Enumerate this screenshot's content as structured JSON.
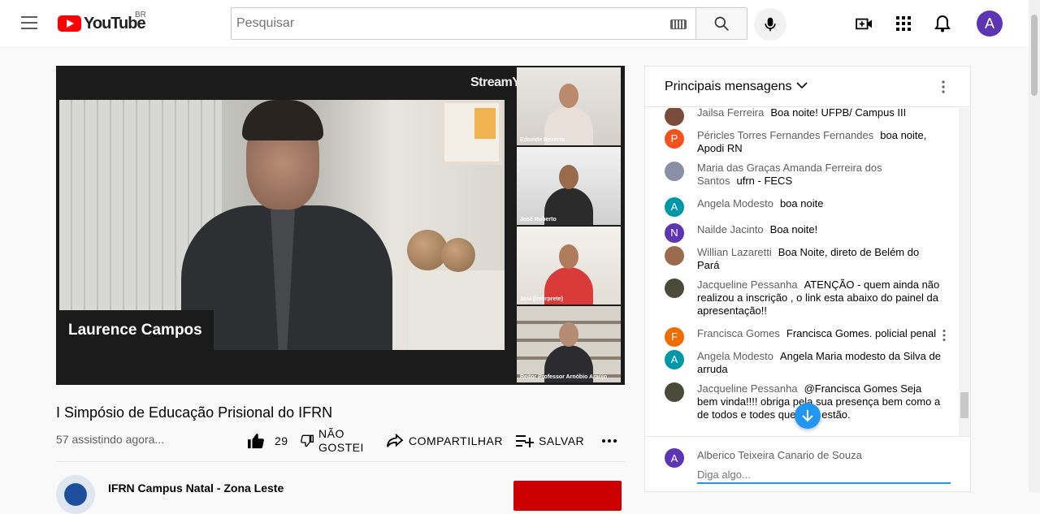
{
  "header": {
    "logo_text": "YouTube",
    "region": "BR",
    "search_placeholder": "Pesquisar",
    "avatar_letter": "A",
    "icons": [
      "menu-icon",
      "keyboard-icon",
      "search-icon",
      "mic-icon",
      "create-video-icon",
      "apps-icon",
      "bell-icon"
    ]
  },
  "video": {
    "brand": "StreamYard",
    "main_speaker": "Laurence Campos",
    "participants": [
      {
        "name": "Edneide Bezerra"
      },
      {
        "name": "José Roberto"
      },
      {
        "name": "Josi (intérprete)"
      },
      {
        "name": "Reitor Professor Arnóbio Araújo"
      }
    ],
    "title": "I Simpósio de Educação Prisional do IFRN",
    "watching": "57 assistindo agora...",
    "likes": "29",
    "dislike_label_1": "NÃO",
    "dislike_label_2": "GOSTEI",
    "share_label": "COMPARTILHAR",
    "save_label": "SALVAR"
  },
  "channel": {
    "name": "IFRN Campus Natal - Zona Leste"
  },
  "chat": {
    "title": "Principais mensagens",
    "messages": [
      {
        "author": "Jailsa Ferreira",
        "text": "Boa noite! UFPB/ Campus III",
        "avatar": "",
        "color": "#7a4a3a"
      },
      {
        "author": "Péricles Torres Fernandes Fernandes",
        "text": "boa noite, Apodi RN",
        "avatar": "P",
        "color": "#f4511e"
      },
      {
        "author": "Maria das Graças Amanda Ferreira dos Santos",
        "text": "ufrn - FECS",
        "avatar": "",
        "color": "#8a8fa8"
      },
      {
        "author": "Angela Modesto",
        "text": "boa noite",
        "avatar": "A",
        "color": "#0097a7"
      },
      {
        "author": "Nailde Jacinto",
        "text": "Boa noite!",
        "avatar": "N",
        "color": "#5e35b1"
      },
      {
        "author": "Willian Lazaretti",
        "text": "Boa Noite, direto de Belém do Pará",
        "avatar": "",
        "color": "#9c6b4e"
      },
      {
        "author": "Jacqueline Pessanha",
        "text": "ATENÇÃO - quem ainda não realizou a inscrição , o link esta abaixo do painel da apresentação!!",
        "avatar": "",
        "color": "#4a4a3a"
      },
      {
        "author": "Francisca Gomes",
        "text": "Francisca Gomes. policial penal",
        "avatar": "F",
        "color": "#ef6c00"
      },
      {
        "author": "Angela Modesto",
        "text": "Angela Maria modesto da Silva de arruda",
        "avatar": "A",
        "color": "#0097a7"
      },
      {
        "author": "Jacqueline Pessanha",
        "text": "@Francisca Gomes Seja bem vinda!!!! obriga pela sua presença bem como a de todos e todes que aqui estão.",
        "avatar": "",
        "color": "#4a4a3a"
      }
    ],
    "input_user": "Alberico Teixeira Canario de Souza",
    "input_avatar": "A",
    "input_placeholder": "Diga algo..."
  }
}
